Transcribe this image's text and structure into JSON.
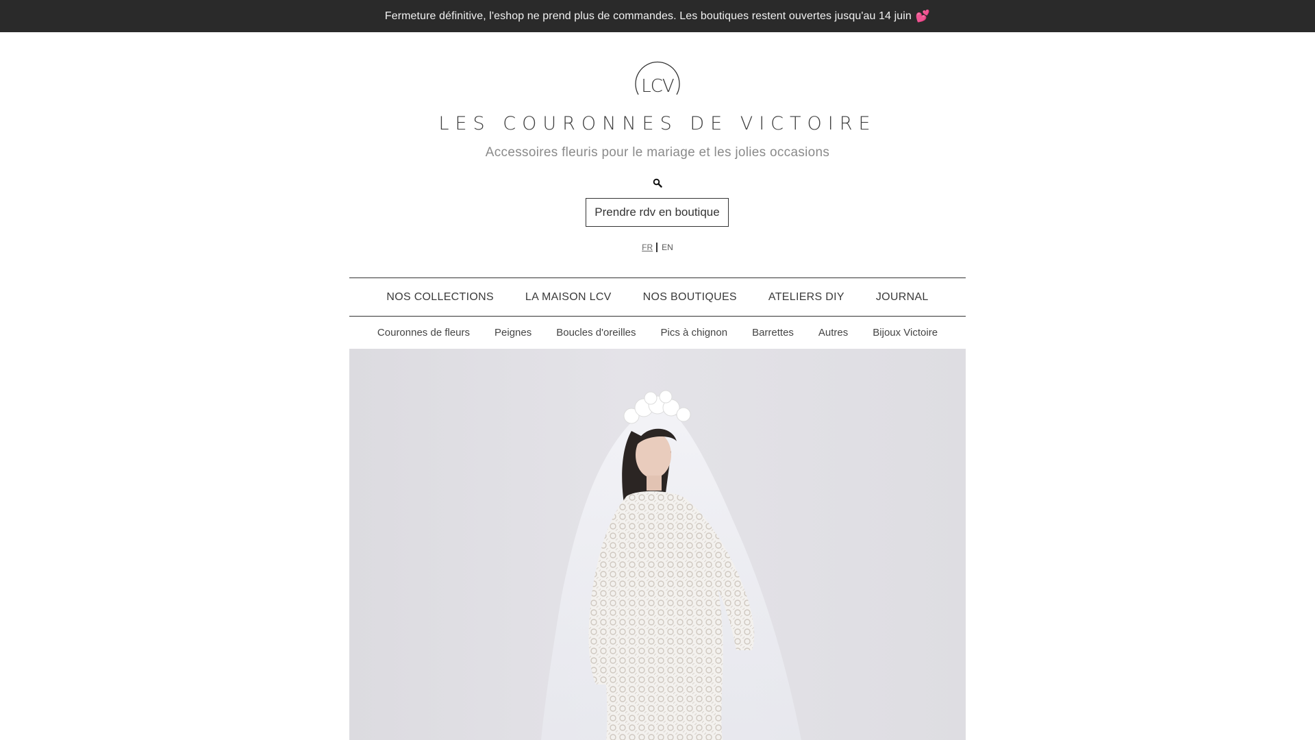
{
  "announcement": {
    "text": "Fermeture définitive, l'eshop ne prend plus de commandes. Les boutiques restent ouvertes jusqu'au 14 juin",
    "emoji": "💕"
  },
  "brand": {
    "logo_text": "LCV",
    "title": "LES COURONNES DE VICTOIRE",
    "tagline": "Accessoires fleuris pour le mariage et les jolies occasions"
  },
  "header": {
    "search_icon": "search-icon",
    "rdv_label": "Prendre rdv en boutique"
  },
  "language": {
    "fr": "FR",
    "en": "EN",
    "active": "FR"
  },
  "main_nav": {
    "items": [
      {
        "label": "NOS COLLECTIONS"
      },
      {
        "label": "LA MAISON LCV"
      },
      {
        "label": "NOS BOUTIQUES"
      },
      {
        "label": "ATELIERS DIY"
      },
      {
        "label": "JOURNAL"
      }
    ]
  },
  "sub_nav": {
    "items": [
      {
        "label": "Couronnes de fleurs"
      },
      {
        "label": "Peignes"
      },
      {
        "label": "Boucles d'oreilles"
      },
      {
        "label": "Pics à chignon"
      },
      {
        "label": "Barrettes"
      },
      {
        "label": "Autres"
      },
      {
        "label": "Bijoux Victoire"
      }
    ]
  },
  "colors": {
    "announcement_bg": "#2a2a2a",
    "text_dark": "#333333",
    "tagline": "#8a8a8a",
    "heart": "#e84393"
  }
}
